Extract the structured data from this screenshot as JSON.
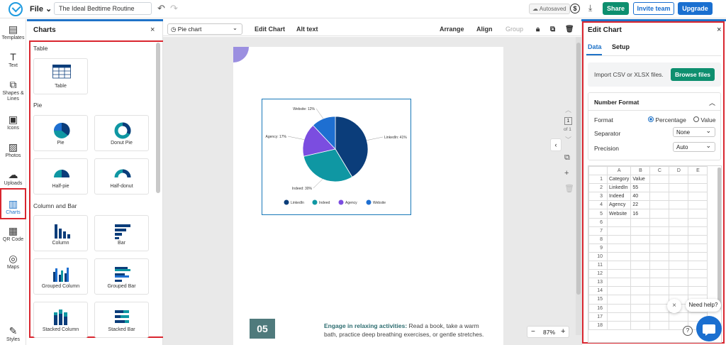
{
  "topbar": {
    "file": "File",
    "doc_title": "The Ideal Bedtime Routine",
    "autosaved": "Autosaved",
    "dollar": "$",
    "share": "Share",
    "invite": "Invite team",
    "upgrade": "Upgrade"
  },
  "leftnav": [
    {
      "label": "Templates",
      "icon": "templates-icon"
    },
    {
      "label": "Text",
      "icon": "text-icon"
    },
    {
      "label": "Shapes & Lines",
      "icon": "shapes-icon"
    },
    {
      "label": "Icons",
      "icon": "icons-icon"
    },
    {
      "label": "Photos",
      "icon": "photos-icon"
    },
    {
      "label": "Uploads",
      "icon": "uploads-icon"
    },
    {
      "label": "Charts",
      "icon": "charts-icon"
    },
    {
      "label": "QR Code",
      "icon": "qr-icon"
    },
    {
      "label": "Maps",
      "icon": "maps-icon"
    },
    {
      "label": "Styles",
      "icon": "styles-icon"
    }
  ],
  "charts_panel": {
    "title": "Charts",
    "close": "×",
    "sections": {
      "table": "Table",
      "pie": "Pie",
      "column": "Column and Bar"
    },
    "cards": {
      "table": "Table",
      "pie": "Pie",
      "donut": "Donut Pie",
      "halfpie": "Half-pie",
      "halfdonut": "Half-donut",
      "column": "Column",
      "bar": "Bar",
      "gcolumn": "Grouped Column",
      "gbar": "Grouped Bar",
      "scolumn": "Stacked Column",
      "sbar": "Stacked Bar"
    }
  },
  "toolbar": {
    "chart_select": "Pie chart",
    "edit_chart": "Edit Chart",
    "alt_text": "Alt text",
    "arrange": "Arrange",
    "align": "Align",
    "group": "Group"
  },
  "page": {
    "step": "05",
    "body_bold": "Engage in relaxing activities:",
    "body_text": " Read a book, take a warm bath, practice deep breathing exercises, or gentle stretches.",
    "page_num": "1",
    "page_of": "of 1",
    "zoom": "87%",
    "zoom_minus": "−",
    "zoom_plus": "+"
  },
  "chart_data": {
    "type": "pie",
    "categories": [
      "LinkedIn",
      "Indeed",
      "Agency",
      "Website"
    ],
    "values": [
      55,
      40,
      22,
      16
    ],
    "labels": [
      "LinkedIn: 41%",
      "Indeed: 30%",
      "Agency: 17%",
      "Website: 12%"
    ],
    "colors": [
      "#0b3d7a",
      "#0f97a3",
      "#7b4de0",
      "#1e6fd1"
    ],
    "legend": "bottom"
  },
  "edit_panel": {
    "title": "Edit Chart",
    "close": "×",
    "tab_data": "Data",
    "tab_setup": "Setup",
    "import_text": "Import CSV or XLSX files.",
    "browse": "Browse files",
    "nf_title": "Number Format",
    "format_label": "Format",
    "pct": "Percentage",
    "val": "Value",
    "separator_label": "Separator",
    "separator": "None",
    "precision_label": "Precision",
    "precision": "Auto",
    "cols": [
      "A",
      "B",
      "C",
      "D",
      "E"
    ],
    "rows": [
      [
        "Category",
        "Value"
      ],
      [
        "LinkedIn",
        "55"
      ],
      [
        "Indeed",
        "40"
      ],
      [
        "Agency",
        "22"
      ],
      [
        "Website",
        "16"
      ]
    ],
    "row_count": 18
  },
  "help": {
    "text": "Need help?",
    "close": "×",
    "q": "?"
  }
}
